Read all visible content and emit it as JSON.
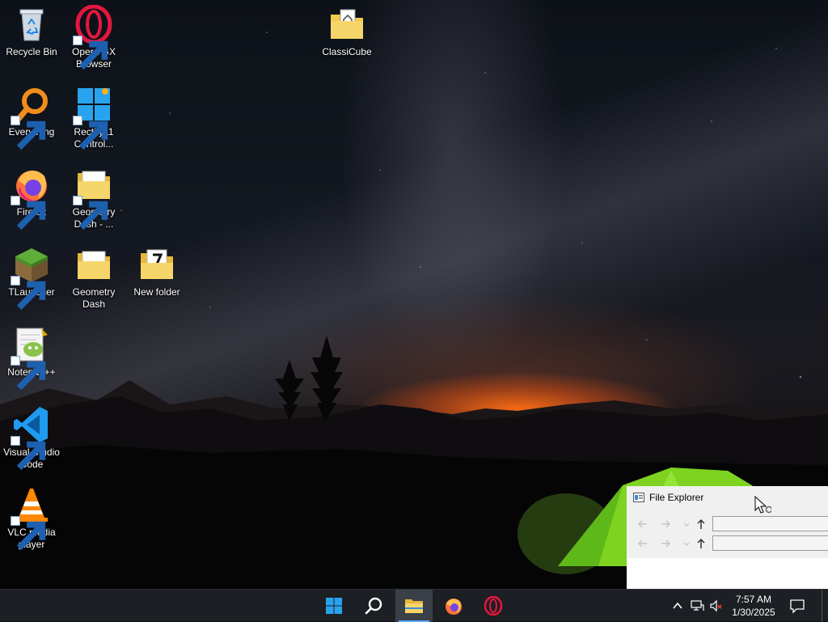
{
  "desktop": {
    "icons": [
      {
        "label": "Recycle Bin",
        "icon": "recycle-bin-icon",
        "shortcut": false
      },
      {
        "label": "Opera GX\nBrowser",
        "icon": "opera-gx-icon",
        "shortcut": true
      },
      {
        "label": "ClassiCube",
        "icon": "classicube-folder-icon",
        "shortcut": false
      },
      {
        "label": "Everything",
        "icon": "everything-search-icon",
        "shortcut": true
      },
      {
        "label": "Rectify11\nControl...",
        "icon": "rectify11-icon",
        "shortcut": true
      },
      {
        "label": "Firefox",
        "icon": "firefox-icon",
        "shortcut": true
      },
      {
        "label": "Geometry\nDash - ...",
        "icon": "folder-icon",
        "shortcut": true
      },
      {
        "label": "TLauncher",
        "icon": "tlauncher-icon",
        "shortcut": true
      },
      {
        "label": "Geometry\nDash",
        "icon": "folder-icon",
        "shortcut": false
      },
      {
        "label": "New folder",
        "icon": "folder-7-icon",
        "shortcut": false
      },
      {
        "label": "Notepad++",
        "icon": "notepadpp-icon",
        "shortcut": true
      },
      {
        "label": "Visual Studio\nCode",
        "icon": "vscode-icon",
        "shortcut": true
      },
      {
        "label": "VLC media\nplayer",
        "icon": "vlc-icon",
        "shortcut": true
      }
    ]
  },
  "explorer": {
    "title": "File Explorer",
    "title_icon": "file-explorer-icon"
  },
  "taskbar": {
    "items": [
      "start-icon",
      "search-icon",
      "file-explorer-icon",
      "firefox-icon",
      "opera-gx-icon"
    ],
    "active": "file-explorer-icon",
    "tray": [
      "chevron-up-icon",
      "network-icon",
      "volume-muted-icon"
    ],
    "time": "7:57 AM",
    "date": "1/30/2025"
  },
  "colors": {
    "taskbar_bg": "#1c1f24",
    "accent": "#5ea8ff",
    "folder": "#f2c94c",
    "glow": "#ff6e14"
  }
}
